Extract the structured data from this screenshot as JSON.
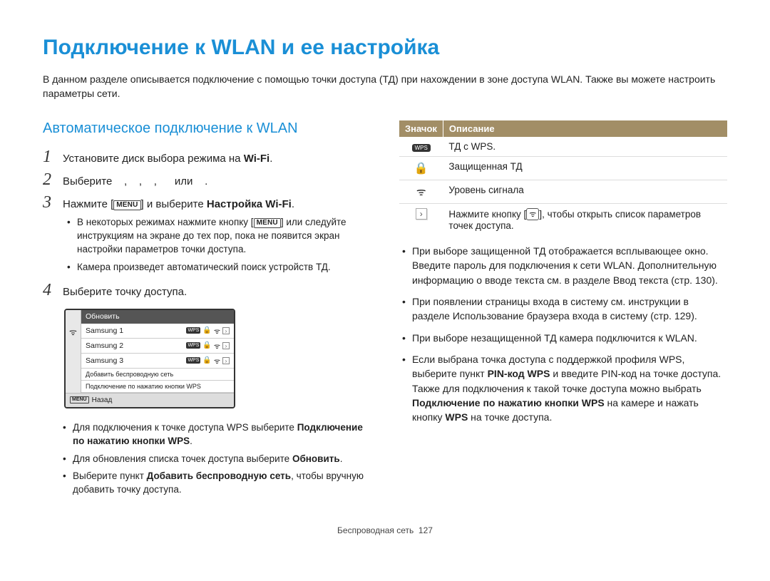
{
  "title": "Подключение к WLAN и ее настройка",
  "intro": "В данном разделе описывается подключение с помощью точки доступа (ТД) при нахождении в зоне доступа WLAN. Также вы можете настроить параметры сети.",
  "section": {
    "heading": "Автоматическое подключение к WLAN",
    "steps": {
      "s1": {
        "num": "1",
        "pre": "Установите диск выбора режима на ",
        "glyph": "Wi-Fi",
        "post": "."
      },
      "s2": {
        "num": "2",
        "pre": "Выберите",
        "mid1": ",",
        "mid2": ",",
        "mid3": ",",
        "or": "или",
        "post": "."
      },
      "s3": {
        "num": "3",
        "pre": "Нажмите [",
        "menu": "MENU",
        "mid": "] и выберите ",
        "bold": "Настройка Wi-Fi",
        "post": "."
      },
      "s3_bullets": [
        "В некоторых режимах нажмите кнопку [MENU] или следуйте инструкциям на экране до тех пор, пока не появится экран настройки параметров точки доступа.",
        "Камера произведет автоматический поиск устройств ТД."
      ],
      "s4": {
        "num": "4",
        "text": "Выберите точку доступа."
      }
    },
    "camera": {
      "refresh": "Обновить",
      "networks": [
        "Samsung 1",
        "Samsung 2",
        "Samsung 3"
      ],
      "add": "Добавить беспроводную сеть",
      "wps": "Подключение по нажатию кнопки WPS",
      "back_label": "Назад",
      "menu_label": "MENU"
    },
    "after_bullets": [
      {
        "pre": "Для подключения к точке доступа WPS выберите ",
        "bold": "Подключение по нажатию кнопки WPS",
        "post": "."
      },
      {
        "pre": "Для обновления списка точек доступа выберите ",
        "bold": "Обновить",
        "post": "."
      },
      {
        "pre": "Выберите пункт ",
        "bold": "Добавить беспроводную сеть",
        "post": ", чтобы вручную добавить точку доступа."
      }
    ]
  },
  "icon_table": {
    "head": {
      "icon": "Значок",
      "desc": "Описание"
    },
    "rows": [
      {
        "type": "wps",
        "desc": "ТД с WPS."
      },
      {
        "type": "lock",
        "desc": "Защищенная ТД"
      },
      {
        "type": "signal",
        "desc": "Уровень сигнала"
      },
      {
        "type": "chev",
        "desc_pre": "Нажмите кнопку [",
        "desc_post": "], чтобы открыть список параметров точек доступа."
      }
    ]
  },
  "right_bullets": [
    {
      "text": "При выборе защищенной ТД отображается всплывающее окно. Введите пароль для подключения к сети WLAN. Дополнительную информацию о вводе текста см. в разделе Ввод текста (стр. 130)."
    },
    {
      "text": "При появлении страницы входа в систему см. инструкции в разделе Использование браузера входа в систему (стр. 129)."
    },
    {
      "text": "При выборе незащищенной ТД камера подключится к WLAN."
    },
    {
      "pre": "Если выбрана точка доступа с поддержкой профиля WPS, выберите пункт ",
      "b1": "PIN-код WPS",
      "mid1": " и введите PIN-код на точке доступа. Также для подключения к такой точке доступа можно выбрать ",
      "b2": "Подключение по нажатию кнопки WPS",
      "mid2": " на камере и нажать кнопку ",
      "b3": "WPS",
      "post": " на точке доступа."
    }
  ],
  "footer": {
    "section": "Беспроводная сеть",
    "page": "127"
  }
}
